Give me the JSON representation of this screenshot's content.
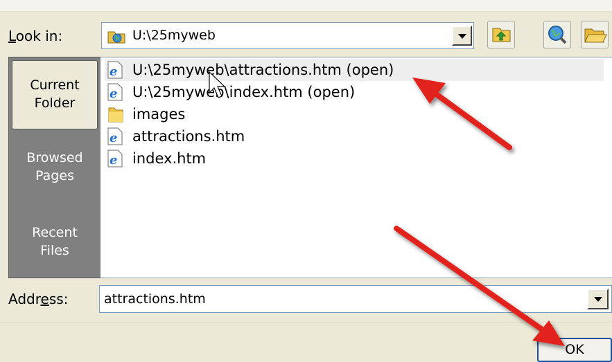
{
  "look_in": {
    "label_first": "L",
    "label_rest": "ook in:",
    "value": "U:\\25myweb"
  },
  "places": [
    {
      "line1": "Current",
      "line2": "Folder"
    },
    {
      "line1": "Browsed",
      "line2": "Pages"
    },
    {
      "line1": "Recent",
      "line2": "Files"
    }
  ],
  "files": [
    "U:\\25myweb\\attractions.htm (open)",
    "U:\\25myweb\\index.htm (open)",
    "images",
    "attractions.htm",
    "index.htm"
  ],
  "address": {
    "label_pre": "Addr",
    "label_u": "e",
    "label_post": "ss:",
    "value": "attractions.htm"
  },
  "ok_label": "OK",
  "colors": {
    "arrow": "#e2231a",
    "selection_border": "#1c4f9c",
    "places_bg": "#808080"
  },
  "icons": [
    "world-folder-icon",
    "up-folder-icon",
    "web-search-icon",
    "browse-folder-icon",
    "ie-file-icon",
    "folder-icon",
    "chevron-down-icon",
    "mouse-cursor-icon"
  ]
}
